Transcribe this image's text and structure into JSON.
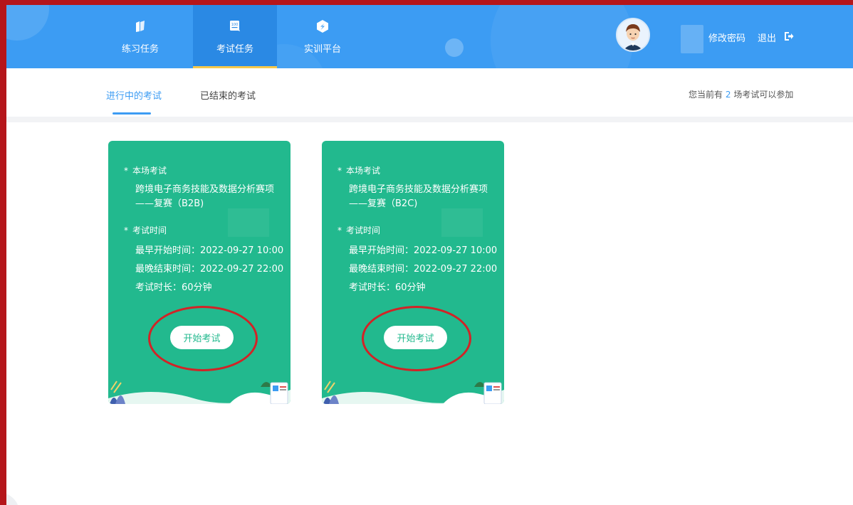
{
  "header": {
    "nav": [
      {
        "label": "练习任务",
        "icon": "practice-icon"
      },
      {
        "label": "考试任务",
        "icon": "exam-icon",
        "active": true
      },
      {
        "label": "实训平台",
        "icon": "training-platform-icon"
      }
    ],
    "change_password": "修改密码",
    "logout": "退出"
  },
  "tabs": {
    "ongoing": "进行中的考试",
    "ended": "已结束的考试",
    "count_prefix": "您当前有",
    "count_value": "2",
    "count_suffix": "场考试可以参加"
  },
  "cards": [
    {
      "section_exam": "本场考试",
      "name": "跨境电子商务技能及数据分析赛项——复赛（B2B)",
      "section_time": "考试时间",
      "earliest_start": "最早开始时间：2022-09-27 10:00",
      "latest_end": "最晚结束时间：2022-09-27 22:00",
      "duration": "考试时长：60分钟",
      "button": "开始考试"
    },
    {
      "section_exam": "本场考试",
      "name": "跨境电子商务技能及数据分析赛项——复赛（B2C)",
      "section_time": "考试时间",
      "earliest_start": "最早开始时间：2022-09-27 10:00",
      "latest_end": "最晚结束时间：2022-09-27 22:00",
      "duration": "考试时长：60分钟",
      "button": "开始考试"
    }
  ],
  "colors": {
    "header_blue": "#3c9cf3",
    "active_nav": "#2a89e4",
    "card_green": "#22b98e",
    "annotation_red": "#d22326",
    "outer_red": "#b5161b"
  }
}
